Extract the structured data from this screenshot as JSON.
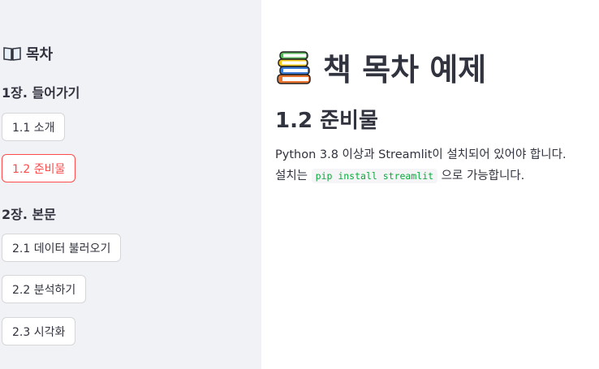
{
  "sidebar": {
    "title": "목차",
    "title_icon": "open-book-icon",
    "chapters": [
      {
        "heading": "1장. 들어가기",
        "items": [
          {
            "label": "1.1 소개",
            "active": false
          },
          {
            "label": "1.2 준비물",
            "active": true
          }
        ]
      },
      {
        "heading": "2장. 본문",
        "items": [
          {
            "label": "2.1 데이터 불러오기",
            "active": false
          },
          {
            "label": "2.2 분석하기",
            "active": false
          },
          {
            "label": "2.3 시각화",
            "active": false
          }
        ]
      }
    ]
  },
  "main": {
    "title": "책 목차 예제",
    "title_icon": "books-icon",
    "section_heading": "1.2 준비물",
    "paragraph_line1": "Python 3.8 이상과 Streamlit이 설치되어 있어야 합니다.",
    "paragraph_line2_prefix": "설치는",
    "paragraph_code": "pip install streamlit",
    "paragraph_line2_suffix": "으로 가능합니다."
  },
  "colors": {
    "sidebar_bg": "#f0f2f6",
    "accent": "#ff4b4b",
    "text": "#31333f",
    "code_text": "#09ab3b"
  }
}
